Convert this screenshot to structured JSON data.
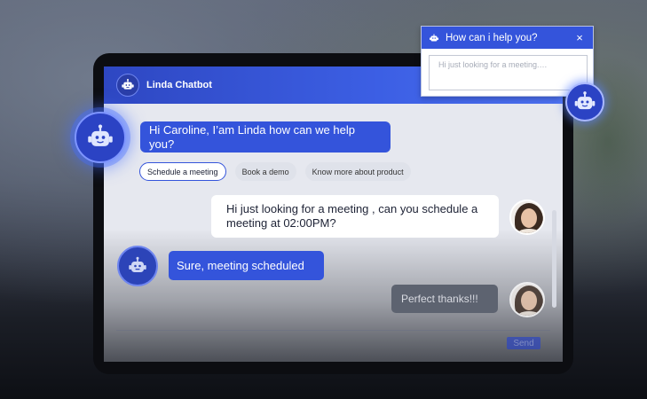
{
  "header": {
    "title": "Linda Chatbot",
    "avatar_icon": "robot-icon"
  },
  "messages": {
    "greeting": "Hi Caroline, I’am Linda how can we help you?",
    "user_request": "Hi just looking for a meeting , can you schedule a meeting at 02:00PM?",
    "bot_confirm": "Sure, meeting scheduled",
    "user_thanks": "Perfect thanks!!!"
  },
  "quick_replies": [
    "Schedule a meeting",
    "Book a demo",
    "Know more about product"
  ],
  "composer": {
    "send_label": "Send"
  },
  "popup": {
    "title": "How can i help you?",
    "close_icon": "×",
    "placeholder": "Hi just looking for a meeting.…"
  },
  "colors": {
    "accent": "#3454db",
    "header_start": "#2e47c2",
    "header_end": "#4c70f0",
    "user_bubble": "#ffffff"
  }
}
